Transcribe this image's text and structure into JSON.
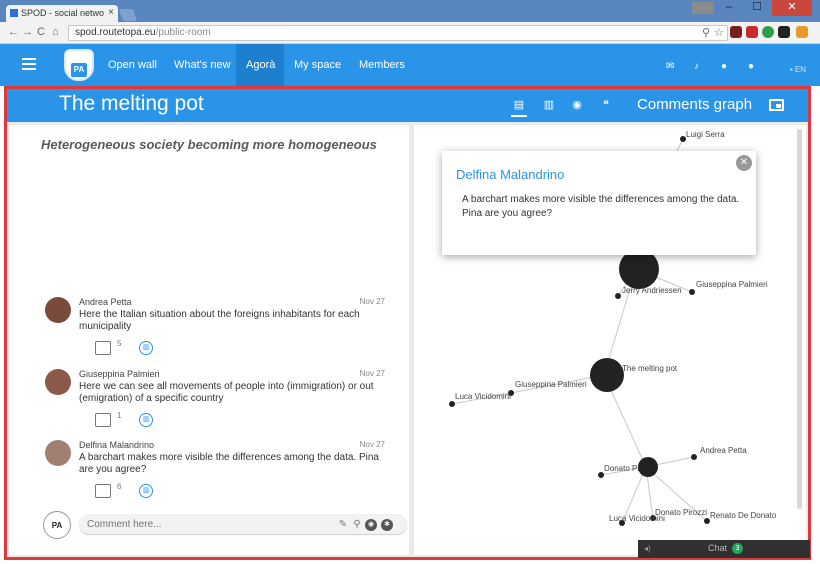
{
  "browser": {
    "tab_title": "SPOD - social netwo",
    "tab_close": "×",
    "url_host": "spod.routetopa.eu",
    "url_path": "/public-room"
  },
  "app": {
    "logo_text": "PA",
    "nav": [
      "Open wall",
      "What's new",
      "Agorà",
      "My space",
      "Members"
    ],
    "active_nav": "Agorà",
    "lang": "EN"
  },
  "room": {
    "title": "The melting pot",
    "subject": "Heterogeneous society becoming more homogeneous",
    "graph_title": "Comments graph"
  },
  "comments": [
    {
      "author": "Andrea Petta",
      "date": "Nov 27",
      "text": "Here the Italian situation about the foreigns inhabitants for each municipality",
      "replies": "5",
      "avatar_color": "#7a4a3a"
    },
    {
      "author": "Giuseppina Palmieri",
      "date": "Nov 27",
      "text": "Here we can see all movements of people into (immigration) or out (emigration) of a specific country",
      "replies": "1",
      "avatar_color": "#8b5a4a"
    },
    {
      "author": "Delfina Malandrino",
      "date": "Nov 27",
      "text": "A barchart makes more visible the differences among the data. Pina are you agree?",
      "replies": "6",
      "avatar_color": "#a08070"
    }
  ],
  "comment_input": {
    "placeholder": "Comment here..."
  },
  "popup": {
    "name": "Delfina Malandrino",
    "text": "A barchart makes more visible the differences among the data. Pina are you agree?",
    "close": "✕"
  },
  "graph": {
    "labels": {
      "luigi": "Luigi Serra",
      "jerry": "Jerry Andriessen",
      "giuseppina1": "Giuseppina Palmieri",
      "melting": "The melting pot",
      "giuseppina2": "Giuseppina Palmieri",
      "luca1": "Luca Vicidomini",
      "andrea": "Andrea Petta",
      "donato": "Donato Pi",
      "donato_pirozzi": "Donato Pirozzi",
      "luca2": "Luca Vicidomini",
      "renato": "Renato De Donato"
    }
  },
  "chat": {
    "label": "Chat",
    "count": "3"
  },
  "colors": {
    "brand_blue": "#2a94e8",
    "frame_red": "#e0383d"
  }
}
